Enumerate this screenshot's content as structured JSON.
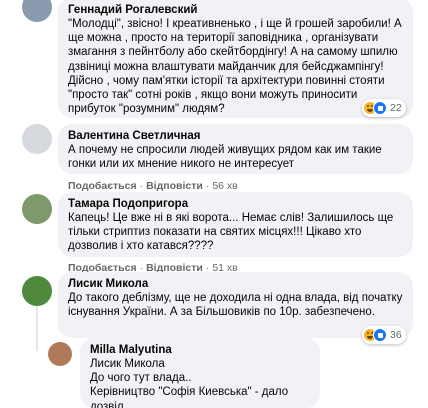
{
  "actions": {
    "like": "Подобається",
    "reply": "Відповісти",
    "dot": "·"
  },
  "comments": [
    {
      "author": "Геннадий Рогалевский",
      "text": "\"Молодці\", звісно! І креативненько , і ще й грошей заробили! А ще можна , просто на території заповідника , організувати змагання з пейнтболу або скейтбордінгу! А на самому шпилю дзвіниці можна влаштувати майданчик для бейсджампінгу! Дійсно , чому пам'ятки історії та архітектури повинні стояти \"просто так\" сотні років , якщо вони можуть приносити прибуток \"розумним\" людям?",
      "time": "",
      "reactions": "22"
    },
    {
      "author": "Валентина Светличная",
      "text": "А почему не спросили людей живущих рядом как им такие гонки или их мнение никого не интересует",
      "time": "56 хв",
      "reactions": ""
    },
    {
      "author": "Тамара Подопригора",
      "text": "Капець! Це вже ні в які ворота... Немає слів! Залишилось ще тільки стриптиз показати на святих місцях!!! Цікаво хто дозволив і хто катався????",
      "time": "51 хв",
      "reactions": ""
    },
    {
      "author": "Лисик Микола",
      "text": "До такого деблізму, ще не доходила ні одна влада, від початку існування України. А за Більшовиків по 10р. забезпечено.",
      "time": "",
      "reactions": "36"
    },
    {
      "author": "Milla Malyutina",
      "text": "Лисик Микола\nДо чого тут влада..\nКерівництво \"Софія Киевська\" - дало дозвіл..\nНе розкидай 💩💩💩",
      "time": "",
      "reactions": ""
    }
  ],
  "icons": {
    "reaction_primary": "haha-icon",
    "reaction_secondary": "like-icon"
  },
  "colors": {
    "bubble": "#f0f2f5",
    "meta": "#65676b",
    "like_blue": "#1877f2"
  }
}
